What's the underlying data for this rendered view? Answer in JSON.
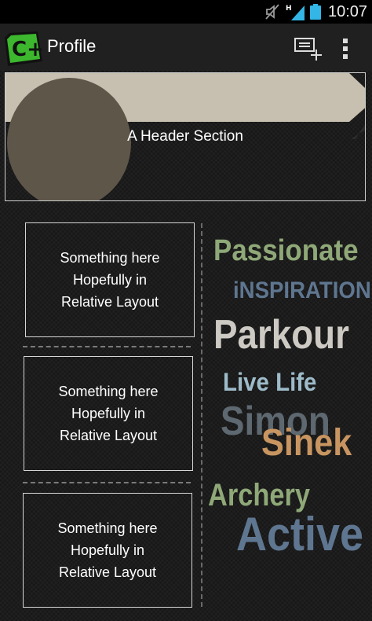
{
  "status_bar": {
    "time": "10:07",
    "network_label": "H",
    "icons": [
      "mute-icon",
      "signal-icon",
      "battery-icon"
    ]
  },
  "action_bar": {
    "title": "Profile",
    "logo_text": "C+",
    "actions": [
      "add-item-icon",
      "overflow-menu-icon"
    ]
  },
  "header": {
    "text": "A Header Section"
  },
  "boxes": [
    {
      "line1": "Something here",
      "line2": "Hopefully in",
      "line3": "Relative Layout"
    },
    {
      "line1": "Something here",
      "line2": "Hopefully in",
      "line3": "Relative Layout"
    },
    {
      "line1": "Something here",
      "line2": "Hopefully in",
      "line3": "Relative Layout"
    }
  ],
  "word_cloud": [
    {
      "text": "Passionate",
      "color": "#8fa878"
    },
    {
      "text": "iNSPIRATION",
      "color": "#5f7690"
    },
    {
      "text": "Parkour",
      "color": "#cdc9c3"
    },
    {
      "text": "Live Life",
      "color": "#9dbbc9"
    },
    {
      "text": "Simon",
      "color": "#5e6870"
    },
    {
      "text": "Sinek",
      "color": "#c89561"
    },
    {
      "text": "Archery",
      "color": "#8fa878"
    },
    {
      "text": "Active",
      "color": "#5f7690"
    }
  ],
  "colors": {
    "status_bar_bg": "#000000",
    "action_bar_bg": "#202020",
    "logo_green": "#3cb72e",
    "banner": "#c7bfb0",
    "header_circle": "#5e5649"
  }
}
